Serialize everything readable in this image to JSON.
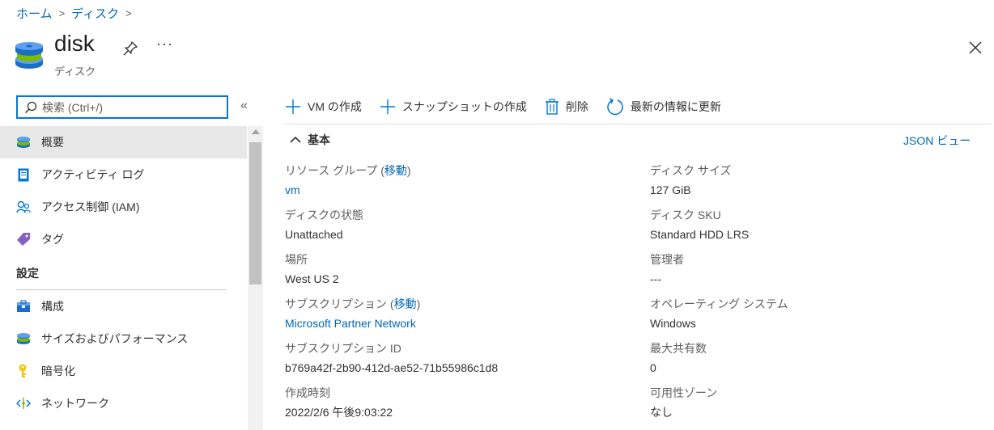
{
  "breadcrumb": {
    "home": "ホーム",
    "disks": "ディスク",
    "sep": ">"
  },
  "header": {
    "title": "disk",
    "subtitle": "ディスク",
    "more": "···"
  },
  "search": {
    "placeholder": "検索 (Ctrl+/)"
  },
  "sidebar": {
    "collapse": "«",
    "items": [
      {
        "label": "概要",
        "icon": "disk-icon"
      },
      {
        "label": "アクティビティ ログ",
        "icon": "activity-log-icon"
      },
      {
        "label": "アクセス制御 (IAM)",
        "icon": "iam-icon"
      },
      {
        "label": "タグ",
        "icon": "tag-icon"
      }
    ],
    "section_settings": "設定",
    "settings_items": [
      {
        "label": "構成",
        "icon": "configuration-icon"
      },
      {
        "label": "サイズおよびパフォーマンス",
        "icon": "size-performance-icon"
      },
      {
        "label": "暗号化",
        "icon": "encryption-key-icon"
      },
      {
        "label": "ネットワーク",
        "icon": "network-icon"
      }
    ]
  },
  "toolbar": {
    "create_vm": "VM の作成",
    "create_snapshot": "スナップショットの作成",
    "delete": "削除",
    "refresh": "最新の情報に更新"
  },
  "essentials": {
    "title": "基本",
    "json_view": "JSON ビュー",
    "left": [
      {
        "label": "リソース グループ (",
        "move": "移動",
        "close_paren": ")",
        "value": "vm",
        "link": true
      },
      {
        "label": "ディスクの状態",
        "value": "Unattached"
      },
      {
        "label": "場所",
        "value": "West US 2"
      },
      {
        "label": "サブスクリプション (",
        "move": "移動",
        "close_paren": ")",
        "value": "Microsoft Partner Network",
        "link": true
      },
      {
        "label": "サブスクリプション ID",
        "value": "b769a42f-2b90-412d-ae52-71b55986c1d8"
      },
      {
        "label": "作成時刻",
        "value": "2022/2/6 午後9:03:22"
      }
    ],
    "right": [
      {
        "label": "ディスク サイズ",
        "value": "127 GiB"
      },
      {
        "label": "ディスク SKU",
        "value": "Standard HDD LRS"
      },
      {
        "label": "管理者",
        "value": "---"
      },
      {
        "label": "オペレーティング システム",
        "value": "Windows"
      },
      {
        "label": "最大共有数",
        "value": "0"
      },
      {
        "label": "可用性ゾーン",
        "value": "なし"
      }
    ]
  },
  "colors": {
    "accent": "#0078d4",
    "link": "#0067b8",
    "active_bg": "#e8e8e8"
  }
}
